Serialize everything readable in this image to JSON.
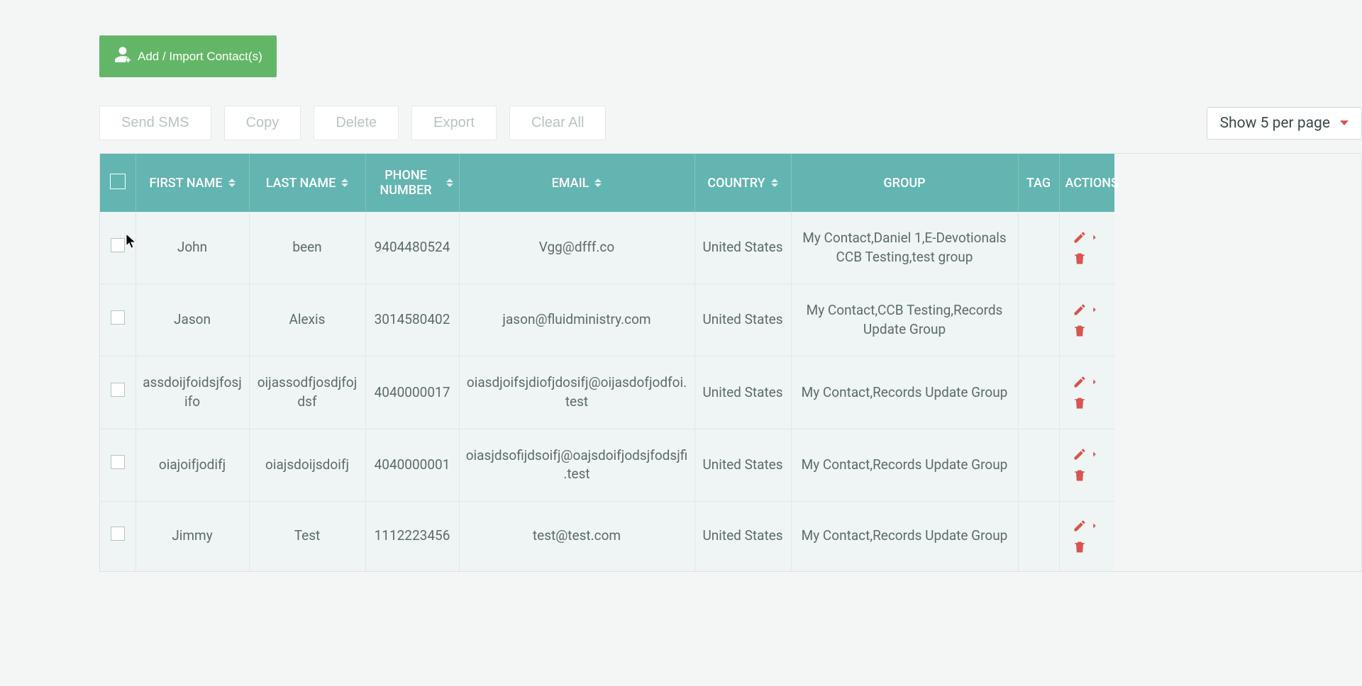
{
  "add_import_label": "Add / Import Contact(s)",
  "toolbar": {
    "send_sms": "Send SMS",
    "copy": "Copy",
    "delete": "Delete",
    "export": "Export",
    "clear_all": "Clear All"
  },
  "page_size_label": "Show 5 per page",
  "columns": {
    "first_name": "FIRST NAME",
    "last_name": "LAST NAME",
    "phone_number": "PHONE NUMBER",
    "email": "EMAIL",
    "country": "COUNTRY",
    "group": "GROUP",
    "tag": "TAG",
    "actions": "ACTIONS"
  },
  "rows": [
    {
      "first_name": "John",
      "last_name": "been",
      "phone": "9404480524",
      "email": "Vgg@dfff.co",
      "country": "United States",
      "group": "My Contact,Daniel 1,E-Devotionals CCB Testing,test group",
      "tag": ""
    },
    {
      "first_name": "Jason",
      "last_name": "Alexis",
      "phone": "3014580402",
      "email": "jason@fluidministry.com",
      "country": "United States",
      "group": "My Contact,CCB Testing,Records Update Group",
      "tag": ""
    },
    {
      "first_name": "assdoijfoidsjfosjifo",
      "last_name": "oijassodfjosdjfojdsf",
      "phone": "4040000017",
      "email": "oiasdjoifsjdiofjdosifj@oijasdofjodfoi.test",
      "country": "United States",
      "group": "My Contact,Records Update Group",
      "tag": ""
    },
    {
      "first_name": "oiajoifjodifj",
      "last_name": "oiajsdoijsdoifj",
      "phone": "4040000001",
      "email": "oiasjdsofijdsoifj@oajsdoifjodsjfodsjfi.test",
      "country": "United States",
      "group": "My Contact,Records Update Group",
      "tag": ""
    },
    {
      "first_name": "Jimmy",
      "last_name": "Test",
      "phone": "1112223456",
      "email": "test@test.com",
      "country": "United States",
      "group": "My Contact,Records Update Group",
      "tag": ""
    }
  ]
}
